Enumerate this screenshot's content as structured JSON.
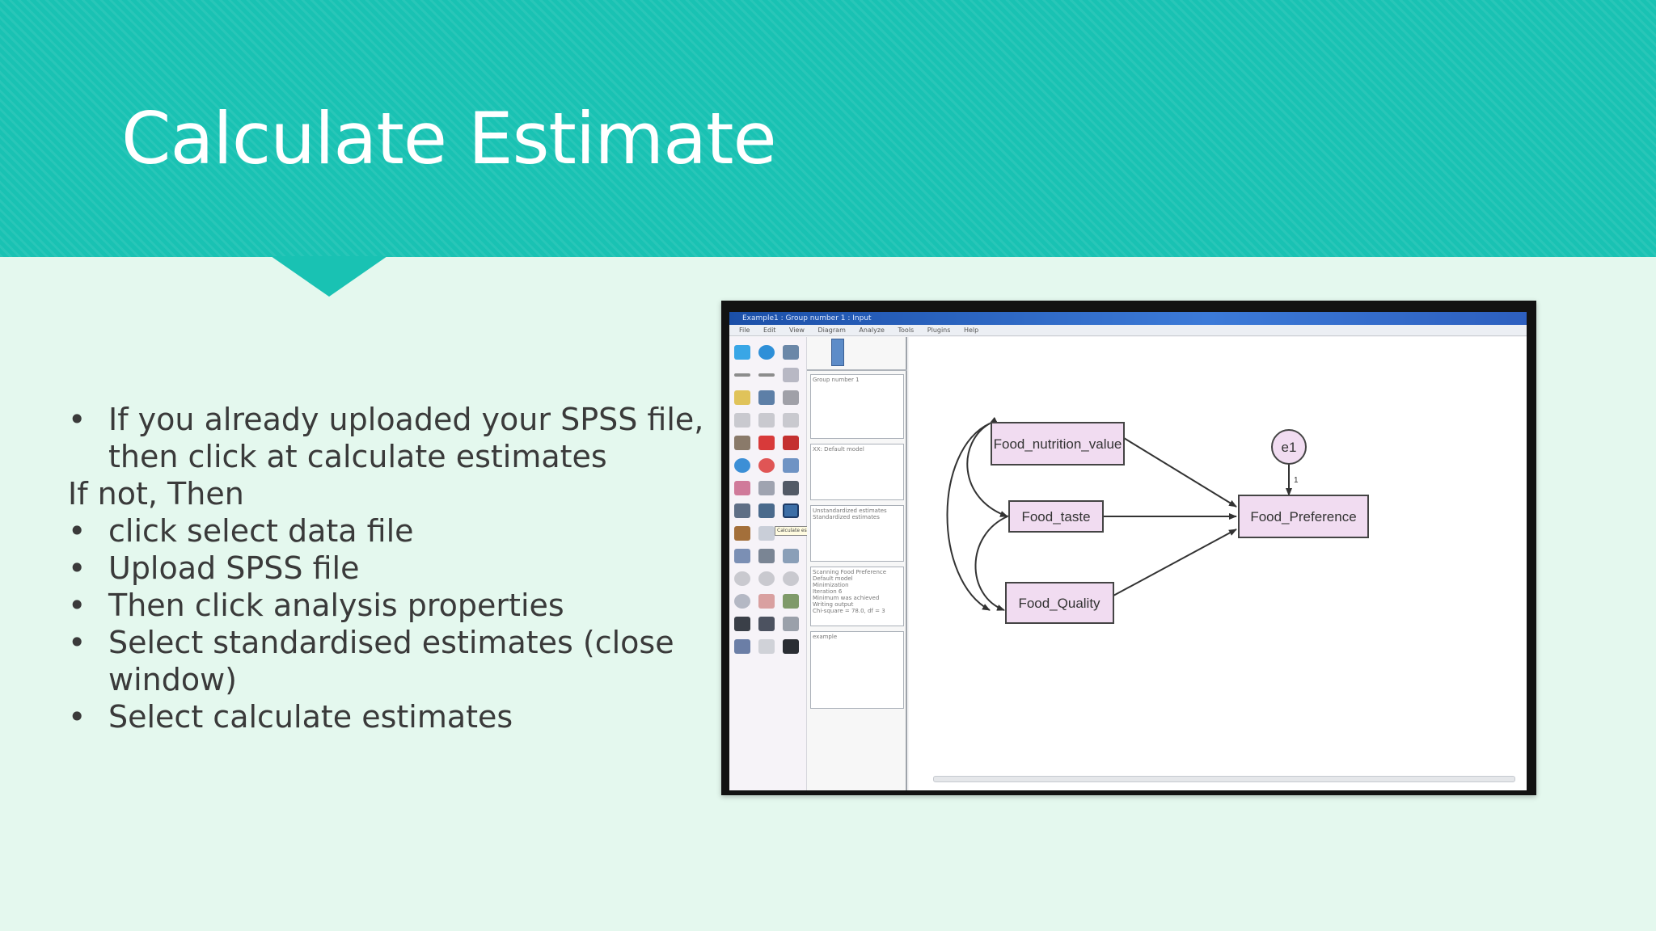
{
  "slide": {
    "title": "Calculate Estimate",
    "bullets": [
      {
        "type": "bullet",
        "lines": [
          "If you already uploaded your SPSS file,",
          "then click at calculate estimates"
        ]
      },
      {
        "type": "plain",
        "lines": [
          "If not, Then"
        ]
      },
      {
        "type": "bullet",
        "lines": [
          "click select data file"
        ]
      },
      {
        "type": "bullet",
        "lines": [
          "Upload SPSS file"
        ]
      },
      {
        "type": "bullet",
        "lines": [
          "Then click analysis properties"
        ]
      },
      {
        "type": "bullet",
        "lines": [
          "Select standardised estimates (close",
          "window)"
        ]
      },
      {
        "type": "bullet",
        "lines": [
          "Select calculate estimates"
        ]
      }
    ],
    "bullet_char": "•"
  },
  "screenshot": {
    "app_title": "Example1 : Group number 1 : Input",
    "menu": [
      "File",
      "Edit",
      "View",
      "Diagram",
      "Analyze",
      "Tools",
      "Plugins",
      "Help"
    ],
    "panels": [
      "Group number 1",
      "XX: Default model",
      "Unstandardized estimates",
      "Standardized estimates",
      "Scanning Food Preference",
      "Default model",
      "Minimization",
      "Iteration 6",
      "Minimum was achieved",
      "Writing output",
      "Chi-square = 78.0, df = 3",
      "example"
    ],
    "tooltip": "Calculate estimates",
    "diagram": {
      "nodes": [
        "Food_nutrition_value",
        "Food_taste",
        "Food_Quality",
        "Food_Preference"
      ],
      "error_term": "e1",
      "error_weight": "1"
    }
  },
  "colors": {
    "header": "#19c2b3",
    "background": "#e4f8ee",
    "title_text": "#ffffff",
    "body_text": "#3a3a3a",
    "node_fill": "#f1dcf1",
    "node_stroke": "#444444"
  }
}
